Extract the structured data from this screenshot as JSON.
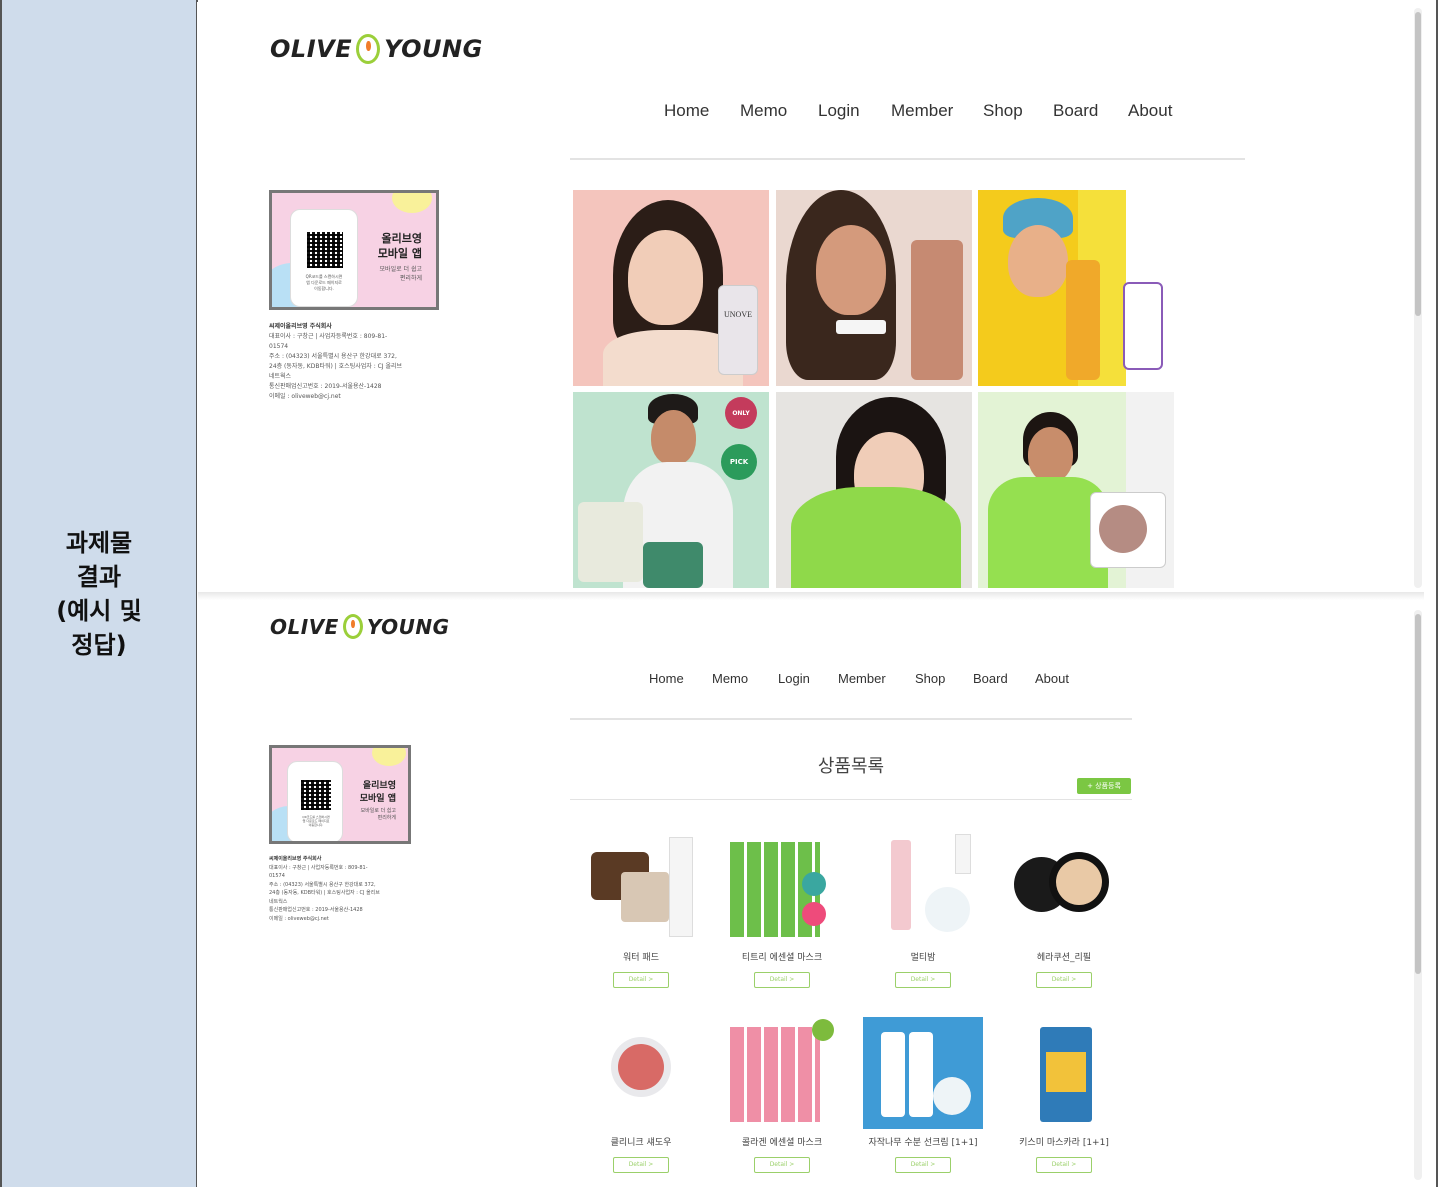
{
  "label": {
    "text": "과제물\n결과\n(예시 및\n정답)"
  },
  "screen1": {
    "logo": {
      "left": "OLIVE",
      "right": "YOUNG"
    },
    "nav": [
      "Home",
      "Memo",
      "Login",
      "Member",
      "Shop",
      "Board",
      "About"
    ],
    "qr_card": {
      "title": "올리브영\n모바일 앱",
      "sub": "모바일로 더 쉽고\n편리하게",
      "qr_note": "QR코드를 스캔하시면\n앱 다운로드 페이지로\n이동합니다."
    },
    "company": {
      "name": "씨제이올리브영 주식회사",
      "lines": "대표이사 : 구창근 | 사업자등록번호 : 809-81-\n01574\n주소 : (04323) 서울특별시 용산구 한강대로 372,\n24층 (동자동, KDB타워) | 호스팅사업자 : CJ 올리브\n네트웍스\n통신판매업신고번호 : 2019-서울용산-1428\n이메일 : oliveweb@cj.net"
    },
    "photo_labels": [
      "UNOVE",
      "ONLY",
      "PICK"
    ]
  },
  "screen2": {
    "logo": {
      "left": "OLIVE",
      "right": "YOUNG"
    },
    "nav": [
      "Home",
      "Memo",
      "Login",
      "Member",
      "Shop",
      "Board",
      "About"
    ],
    "qr_card": {
      "title": "올리브영\n모바일 앱",
      "sub": "모바일로 더 쉽고\n편리하게",
      "qr_note": "QR코드를 스캔하시면\n앱 다운로드 페이지로\n이동합니다."
    },
    "company": {
      "name": "씨제이올리브영 주식회사",
      "lines": "대표이사 : 구창근 | 사업자등록번호 : 809-81-\n01574\n주소 : (04323) 서울특별시 용산구 한강대로 372,\n24층 (동자동, KDB타워) | 호스팅사업자 : CJ 올리브\n네트웍스\n통신판매업신고번호 : 2019-서울용산-1428\n이메일 : oliveweb@cj.net"
    },
    "page_title": "상품목록",
    "add_button": "+ 상품등록",
    "detail_label": "Detail >",
    "products": [
      {
        "name": "워터 패드"
      },
      {
        "name": "티트리 에센셜 마스크"
      },
      {
        "name": "멀티밤"
      },
      {
        "name": "헤라쿠션_리필"
      },
      {
        "name": "클리니크 섀도우"
      },
      {
        "name": "콜라겐 에센셜 마스크"
      },
      {
        "name": "자작나무 수분 선크림 [1+1]"
      },
      {
        "name": "키스미 마스카라 [1+1]"
      }
    ]
  },
  "colors": {
    "label_bg": "#cfdceb",
    "brand_green": "#9bcf3a",
    "brand_orange": "#f07c2a",
    "button_green": "#7bc743",
    "card_pink": "#f7d2e4"
  }
}
